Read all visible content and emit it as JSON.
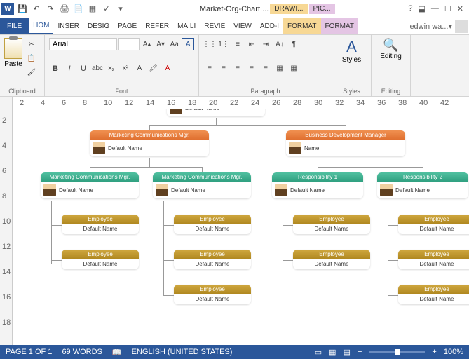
{
  "title": "Market-Org-Chart....",
  "context_tabs": {
    "drawing": "DRAWI...",
    "picture": "PIC..."
  },
  "user": "edwin wa...",
  "tabs": {
    "file": "FILE",
    "home": "HOM",
    "insert": "INSER",
    "design": "DESIG",
    "page": "PAGE",
    "refer": "REFER",
    "mail": "MAILI",
    "review": "REVIE",
    "view": "VIEW",
    "addin": "ADD-I",
    "format1": "FORMAT",
    "format2": "FORMAT"
  },
  "ribbon": {
    "clipboard": {
      "paste": "Paste",
      "label": "Clipboard"
    },
    "font": {
      "name": "Arial",
      "label": "Font"
    },
    "paragraph": {
      "label": "Paragraph"
    },
    "styles": {
      "label": "Styles",
      "btn": "Styles"
    },
    "editing": {
      "label": "Editing",
      "btn": "Editing"
    }
  },
  "ruler_h": [
    "2",
    "4",
    "6",
    "8",
    "10",
    "12",
    "14",
    "16",
    "18",
    "20",
    "22",
    "24",
    "26",
    "28",
    "30",
    "32",
    "34",
    "36",
    "38",
    "40",
    "42"
  ],
  "ruler_v": [
    "2",
    "4",
    "6",
    "8",
    "10",
    "12",
    "14",
    "16",
    "18"
  ],
  "org": {
    "top": {
      "title": "",
      "name": "Default Name"
    },
    "l2a": {
      "title": "Marketing Communications Mgr.",
      "name": "Default Name"
    },
    "l2b": {
      "title": "Business Development Manager",
      "name": "Name"
    },
    "l3a": {
      "title": "Marketing Communications Mgr.",
      "name": "Default Name"
    },
    "l3b": {
      "title": "Marketing Communications Mgr.",
      "name": "Default Name"
    },
    "l3c": {
      "title": "Responsibility 1",
      "name": "Default Name"
    },
    "l3d": {
      "title": "Responsibility 2",
      "name": "Default Name"
    },
    "emp": {
      "title": "Employee",
      "name": "Default Name"
    }
  },
  "status": {
    "page": "PAGE 1 OF 1",
    "words": "69 WORDS",
    "lang": "ENGLISH (UNITED STATES)",
    "zoom": "100%"
  }
}
